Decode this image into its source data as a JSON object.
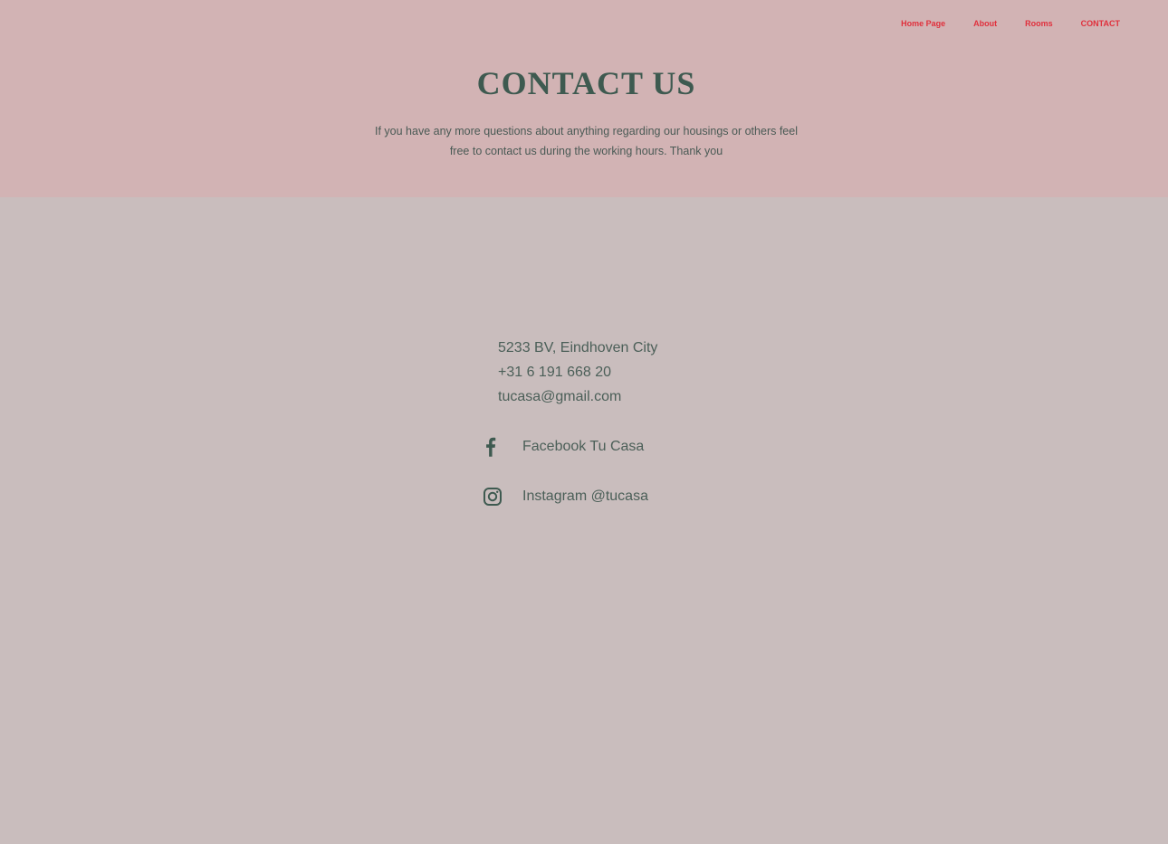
{
  "nav": {
    "items": [
      {
        "label": "Home Page"
      },
      {
        "label": "About"
      },
      {
        "label": "Rooms"
      },
      {
        "label": "CONTACT"
      }
    ]
  },
  "hero": {
    "title": "CONTACT US",
    "subtitle_line1": "If you have any more questions about anything regarding our housings or others feel",
    "subtitle_line2": "free to contact us during the working hours. Thank you"
  },
  "contact": {
    "address": "5233 BV, Eindhoven City",
    "phone": "+31 6 191 668 20",
    "email": "tucasa@gmail.com"
  },
  "social": {
    "facebook": {
      "label": "Facebook Tu Casa",
      "icon": "facebook-icon"
    },
    "instagram": {
      "label": "Instagram @tucasa",
      "icon": "instagram-icon"
    }
  },
  "colors": {
    "hero_bg": "#d2b3b4",
    "page_bg": "#c9bdbd",
    "nav_link": "#e0303c",
    "heading": "#3e5a50",
    "text": "#4b5f58"
  }
}
